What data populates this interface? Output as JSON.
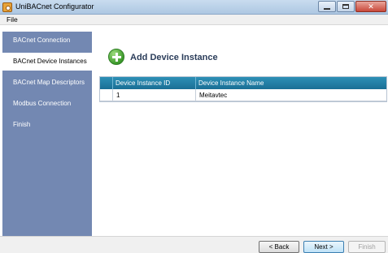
{
  "window": {
    "title": "UniBACnet Configurator"
  },
  "menubar": {
    "file": "File"
  },
  "sidebar": {
    "items": [
      {
        "label": "BACnet Connection",
        "active": false
      },
      {
        "label": "BACnet Device Instances",
        "active": true
      },
      {
        "label": "BACnet Map Descriptors",
        "active": false
      },
      {
        "label": "Modbus Connection",
        "active": false
      },
      {
        "label": "Finish",
        "active": false
      }
    ]
  },
  "main": {
    "title": "Add Device Instance",
    "icon": "add-icon",
    "table": {
      "columns": [
        "Device Instance ID",
        "Device Instance Name"
      ],
      "rows": [
        {
          "id": "1",
          "name": "Meitavtec"
        }
      ]
    }
  },
  "footer": {
    "back_label": "< Back",
    "next_label": "Next >",
    "finish_label": "Finish",
    "finish_enabled": false
  },
  "colors": {
    "sidebar_bg": "#7388b2",
    "grid_header": "#2d8fb6",
    "title_text": "#2b3d5a"
  }
}
